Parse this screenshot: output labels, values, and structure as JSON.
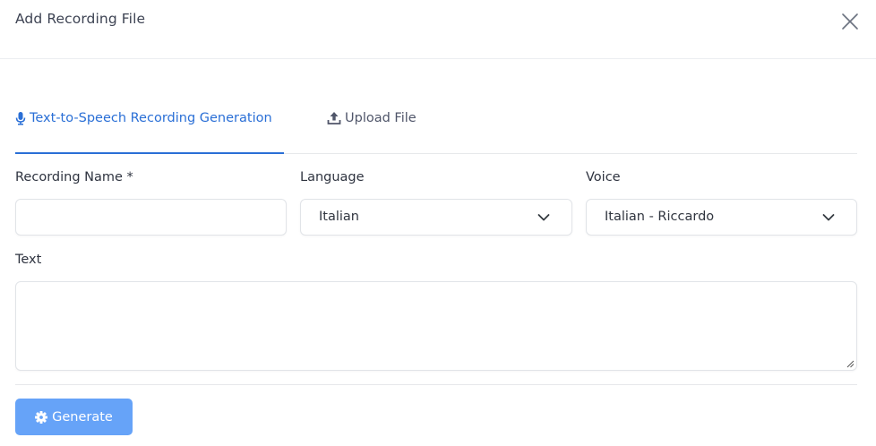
{
  "modal": {
    "title": "Add Recording File",
    "close_icon": "close-icon"
  },
  "tabs": [
    {
      "label": "Text-to-Speech Recording Generation",
      "icon": "microphone-icon",
      "active": true
    },
    {
      "label": "Upload File",
      "icon": "upload-icon",
      "active": false
    }
  ],
  "form": {
    "recording_name": {
      "label": "Recording Name *",
      "value": "",
      "placeholder": ""
    },
    "language": {
      "label": "Language",
      "value": "Italian"
    },
    "voice": {
      "label": "Voice",
      "value": "Italian - Riccardo"
    },
    "text": {
      "label": "Text",
      "value": ""
    }
  },
  "footer": {
    "generate_label": "Generate",
    "generate_icon": "gear-icon"
  },
  "colors": {
    "accent": "#2a6fd6",
    "button": "#66a3f8"
  }
}
